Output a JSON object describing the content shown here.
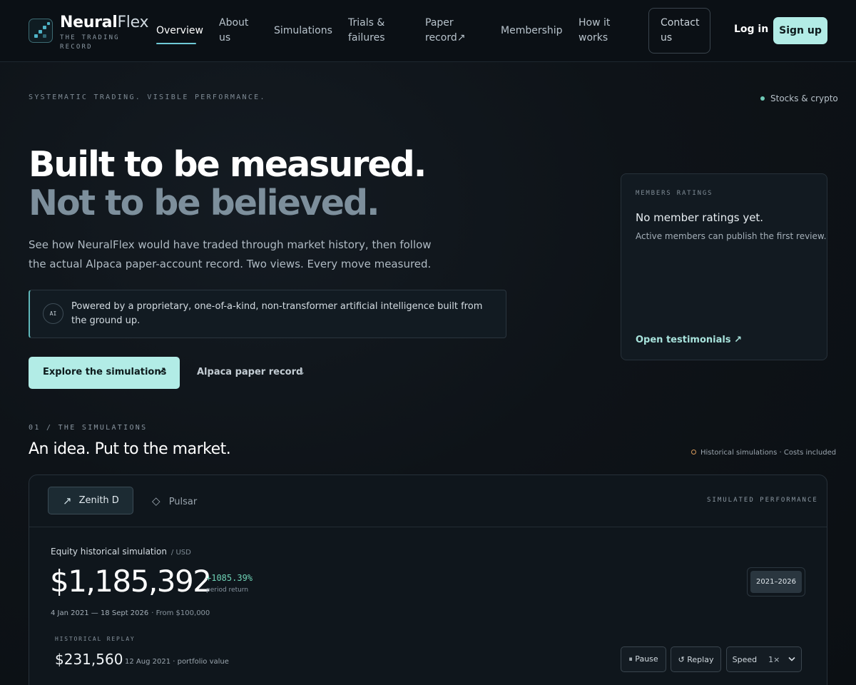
{
  "nav": {
    "brand_bold": "Neural",
    "brand_light": "Flex",
    "brand_sub": "THE TRADING RECORD",
    "items": [
      {
        "label": "Overview",
        "active": true
      },
      {
        "label": "About us"
      },
      {
        "label": "Simulations"
      },
      {
        "label": "Trials & failures"
      },
      {
        "label": "Paper record↗"
      },
      {
        "label": "Membership"
      },
      {
        "label": "How it works"
      }
    ],
    "contact": "Contact us",
    "login": "Log in",
    "signup": "Sign up"
  },
  "hero": {
    "tagline": "SYSTEMATIC TRADING. VISIBLE PERFORMANCE.",
    "market_tag": "Stocks & crypto",
    "headline_1": "Built to be measured.",
    "headline_2": "Not to be believed.",
    "lead": "See how NeuralFlex would have traded through market history, then follow the actual Alpaca paper-account record. Two views. Every move measured.",
    "ai_badge": "AI",
    "ai_text": "Powered by a proprietary, one-of-a-kind, non-transformer artificial intelligence built from the ground up.",
    "cta_primary": "Explore the simulations",
    "cta_primary_icon": "↗",
    "cta_secondary": "Alpaca paper record",
    "cta_secondary_icon": "↓"
  },
  "ratings": {
    "label": "MEMBERS RATINGS",
    "title": "No member ratings yet.",
    "subtitle": "Active members can publish the first review.",
    "link": "Open testimonials ↗"
  },
  "simulations": {
    "section_label": "01 / THE SIMULATIONS",
    "title": "An idea. Put to the market.",
    "note": "Historical simulations · Costs included",
    "tabs": [
      {
        "label": "Zenith D",
        "icon": "↗",
        "active": true
      },
      {
        "label": "Pulsar",
        "icon": "◇"
      }
    ],
    "panel_label": "SIMULATED PERFORMANCE",
    "equity_title": "Equity historical simulation",
    "equity_unit": "/ USD",
    "equity_value": "$1,185,392",
    "equity_return": "+1085.39%",
    "equity_return_label": "period return",
    "date_range": "4 Jan 2021 — 18 Sept 2026",
    "start_note": "· From $100,000",
    "period_selected": "2021–2026",
    "replay_label": "HISTORICAL REPLAY",
    "replay_value": "$231,560",
    "replay_date": "12 Aug 2021 · portfolio value",
    "controls": {
      "pause": "⏸ Pause",
      "replay": "↺ Replay",
      "speed_label": "Speed",
      "speed_value": "1×"
    }
  }
}
